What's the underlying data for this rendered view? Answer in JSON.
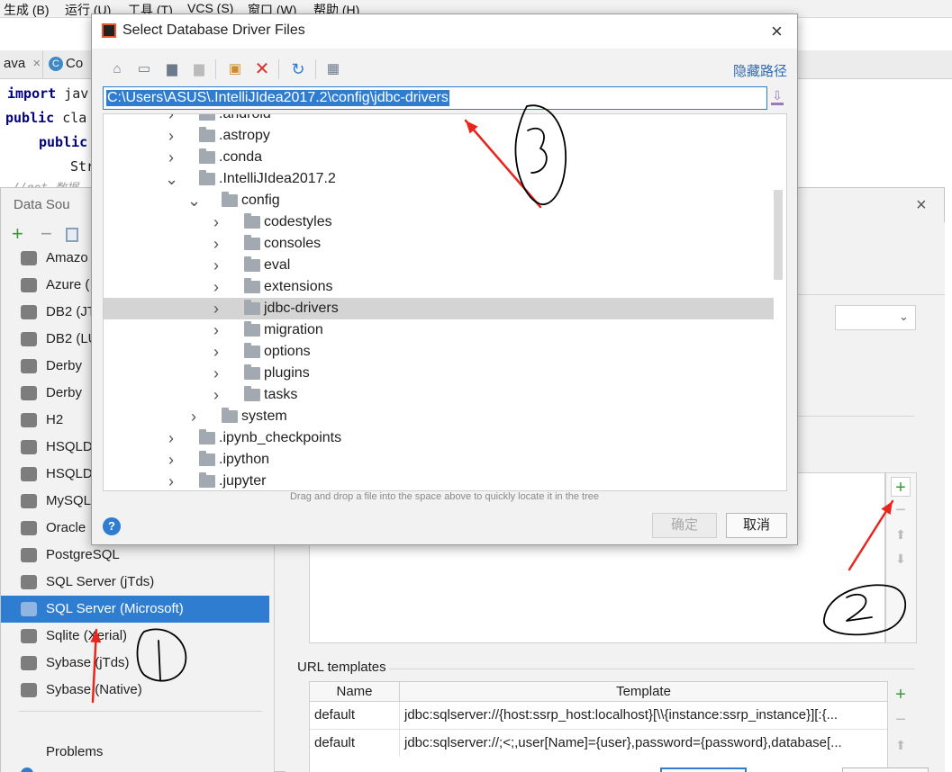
{
  "menubar": {
    "items": [
      "生成 (B)",
      "运行 (U)",
      "工具 (T)",
      "VCS (S)",
      "窗口 (W)",
      "帮助 (H)"
    ]
  },
  "editor": {
    "tabs": [
      {
        "label": "ava",
        "close": "×"
      },
      {
        "label": "Co",
        "badge": "C"
      }
    ],
    "code_lines": [
      {
        "kw": "import",
        "rest": " jav"
      },
      {
        "kw": "public",
        "rest": " cla"
      },
      {
        "kw": "public",
        "rest": ""
      },
      {
        "kw": "",
        "rest": "Str"
      },
      {
        "kw": "",
        "rest": "//get 数据"
      }
    ]
  },
  "datasources_dialog": {
    "title": "Data Sou",
    "close": "×",
    "drivers": [
      {
        "label": "Amazo",
        "icon": "amazon-icon"
      },
      {
        "label": "Azure (",
        "icon": "azure-icon"
      },
      {
        "label": "DB2 (JT",
        "icon": "db2-icon"
      },
      {
        "label": "DB2 (LU",
        "icon": "db2-icon"
      },
      {
        "label": "Derby",
        "icon": "derby-icon"
      },
      {
        "label": "Derby",
        "icon": "derby-icon"
      },
      {
        "label": "H2",
        "icon": "h2-icon"
      },
      {
        "label": "HSQLD",
        "icon": "hsqldb-icon"
      },
      {
        "label": "HSQLD",
        "icon": "hsqldb-icon"
      },
      {
        "label": "MySQL",
        "icon": "mysql-icon"
      },
      {
        "label": "Oracle",
        "icon": "oracle-icon"
      },
      {
        "label": "PostgreSQL",
        "icon": "postgresql-icon"
      },
      {
        "label": "SQL Server (jTds)",
        "icon": "sqlserver-icon"
      },
      {
        "label": "SQL Server (Microsoft)",
        "icon": "sqlserver-icon",
        "selected": true
      },
      {
        "label": "Sqlite (Xerial)",
        "icon": "sqlite-icon"
      },
      {
        "label": "Sybase (jTds)",
        "icon": "sybase-icon"
      },
      {
        "label": "Sybase (Native)",
        "icon": "sybase-icon"
      }
    ],
    "problems_label": "Problems",
    "url_templates_label": "URL templates",
    "url_table": {
      "columns": [
        "Name",
        "Template"
      ],
      "rows": [
        {
          "name": "default",
          "template": "jdbc:sqlserver://{host:ssrp_host:localhost}[\\\\{instance:ssrp_instance}][:{..."
        },
        {
          "name": "default",
          "template": "jdbc:sqlserver://;<;,user[Name]={user},password={password},database[..."
        }
      ]
    }
  },
  "modal": {
    "title": "Select Database Driver Files",
    "close": "×",
    "hide_path_label": "隐藏路径",
    "path_value": "C:\\Users\\ASUS\\.IntelliJIdea2017.2\\config\\jdbc-drivers",
    "tree": [
      {
        "label": ".android",
        "depth": 0,
        "expanded": false
      },
      {
        "label": ".astropy",
        "depth": 0,
        "expanded": false
      },
      {
        "label": ".conda",
        "depth": 0,
        "expanded": false
      },
      {
        "label": ".IntelliJIdea2017.2",
        "depth": 0,
        "expanded": true
      },
      {
        "label": "config",
        "depth": 1,
        "expanded": true
      },
      {
        "label": "codestyles",
        "depth": 2,
        "expanded": false
      },
      {
        "label": "consoles",
        "depth": 2,
        "expanded": false
      },
      {
        "label": "eval",
        "depth": 2,
        "expanded": false
      },
      {
        "label": "extensions",
        "depth": 2,
        "expanded": false
      },
      {
        "label": "jdbc-drivers",
        "depth": 2,
        "expanded": false,
        "selected": true
      },
      {
        "label": "migration",
        "depth": 2,
        "expanded": false
      },
      {
        "label": "options",
        "depth": 2,
        "expanded": false
      },
      {
        "label": "plugins",
        "depth": 2,
        "expanded": false
      },
      {
        "label": "tasks",
        "depth": 2,
        "expanded": false
      },
      {
        "label": "system",
        "depth": 1,
        "expanded": false
      },
      {
        "label": ".ipynb_checkpoints",
        "depth": 0,
        "expanded": false
      },
      {
        "label": ".ipython",
        "depth": 0,
        "expanded": false
      },
      {
        "label": ".jupyter",
        "depth": 0,
        "expanded": false
      }
    ],
    "hint": "Drag and drop a file into the space above to quickly locate it in the tree",
    "help_label": "?",
    "ok_label": "确定",
    "cancel_label": "取消"
  },
  "annotations": {
    "colors": {
      "arrow": "#e8261e",
      "ink": "#000000"
    }
  }
}
